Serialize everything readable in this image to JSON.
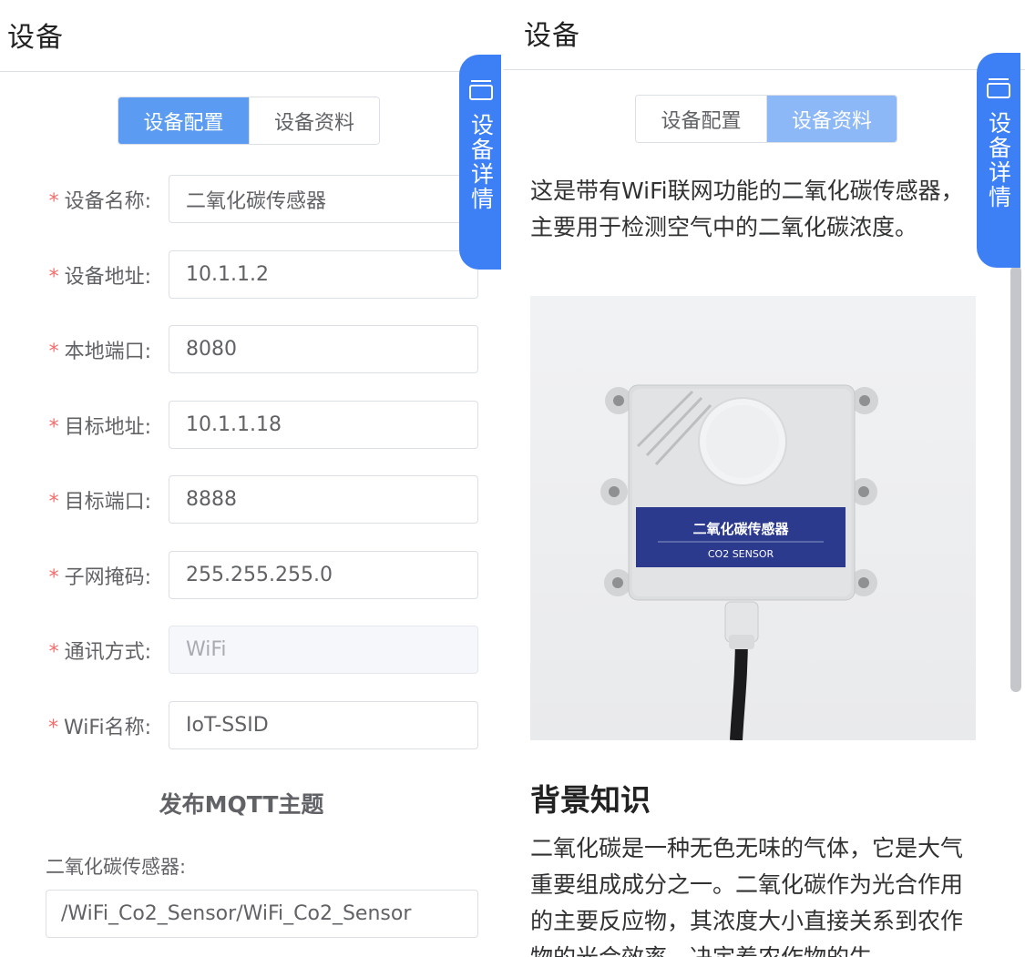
{
  "left": {
    "header_title": "设备",
    "tabs": [
      {
        "label": "设备配置",
        "active": true
      },
      {
        "label": "设备资料",
        "active": false
      }
    ],
    "side_button_label": "设备详情",
    "form": {
      "device_name": {
        "label": "设备名称:",
        "value": "二氧化碳传感器"
      },
      "device_address": {
        "label": "设备地址:",
        "value": "10.1.1.2"
      },
      "local_port": {
        "label": "本地端口:",
        "value": "8080"
      },
      "target_address": {
        "label": "目标地址:",
        "value": "10.1.1.18"
      },
      "target_port": {
        "label": "目标端口:",
        "value": "8888"
      },
      "subnet_mask": {
        "label": "子网掩码:",
        "value": "255.255.255.0"
      },
      "comm_method": {
        "label": "通讯方式:",
        "value": "WiFi"
      },
      "wifi_name": {
        "label": "WiFi名称:",
        "value": "IoT-SSID"
      }
    },
    "required_mark": "*",
    "mqtt_section_title": "发布MQTT主题",
    "mqtt_topic": {
      "label": "二氧化碳传感器:",
      "value": "/WiFi_Co2_Sensor/WiFi_Co2_Sensor"
    }
  },
  "right": {
    "header_title": "设备",
    "tabs": [
      {
        "label": "设备配置",
        "active": false
      },
      {
        "label": "设备资料",
        "active": true
      }
    ],
    "side_button_label": "设备详情",
    "description": "这是带有WiFi联网功能的二氧化碳传感器，主要用于检测空气中的二氧化碳浓度。",
    "photo": {
      "label_cn": "二氧化碳传感器",
      "label_en": "CO2  SENSOR"
    },
    "background_title": "背景知识",
    "background_text": "二氧化碳是一种无色无味的气体，它是大气重要组成成分之一。二氧化碳作为光合作用的主要反应物，其浓度大小直接关系到农作物的光合效率，决定着农作物的生"
  },
  "colors": {
    "primary": "#3d7ff5",
    "tab_active": "#5b9cf2",
    "tab_active_light": "#8cb8f7",
    "required": "#f56c6c"
  }
}
